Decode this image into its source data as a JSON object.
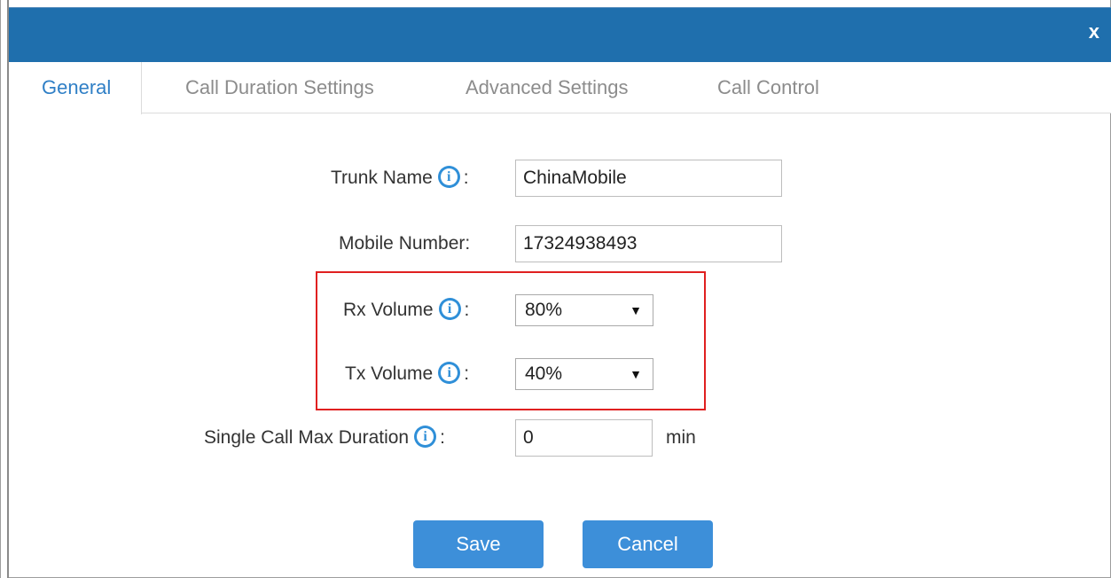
{
  "dialog": {
    "close_label": "x"
  },
  "tabs": [
    {
      "label": "General",
      "active": true
    },
    {
      "label": "Call Duration Settings",
      "active": false
    },
    {
      "label": "Advanced Settings",
      "active": false
    },
    {
      "label": "Call Control",
      "active": false
    }
  ],
  "form": {
    "trunk_name": {
      "label": "Trunk Name",
      "separator": ":",
      "value": "ChinaMobile"
    },
    "mobile_number": {
      "label": "Mobile Number:",
      "value": "17324938493"
    },
    "rx_volume": {
      "label": "Rx Volume",
      "separator": ":",
      "selected": "80%"
    },
    "tx_volume": {
      "label": "Tx Volume",
      "separator": ":",
      "selected": "40%"
    },
    "single_call_max_duration": {
      "label": "Single Call Max Duration",
      "separator": ":",
      "value": "0",
      "unit": "min"
    }
  },
  "buttons": {
    "save": "Save",
    "cancel": "Cancel"
  },
  "icons": {
    "info": "info-icon",
    "close": "close-icon",
    "dropdown": "chevron-down-icon"
  },
  "colors": {
    "titlebar": "#1f6fad",
    "active_tab": "#2f7fc6",
    "info_icon": "#2f8fd8",
    "button": "#3d8fd9",
    "highlight": "#e02020"
  }
}
